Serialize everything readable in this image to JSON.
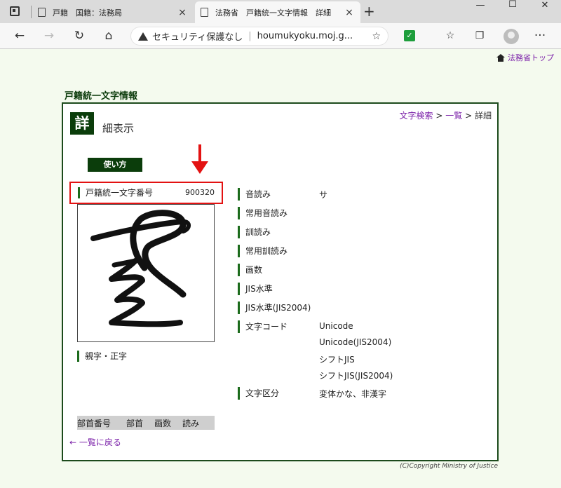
{
  "browser": {
    "tabs": [
      {
        "title": "戸籍　国籍：法務局",
        "close": "×"
      },
      {
        "title": "法務省　戸籍統一文字情報　詳細",
        "close": "×"
      }
    ],
    "new_tab": "+",
    "window": {
      "minimize": "—",
      "maximize": "☐",
      "close": "✕"
    },
    "nav": {
      "back": "←",
      "forward": "→",
      "reload": "↻",
      "home": "⌂"
    },
    "security_text": "セキュリティ保護なし",
    "url": "houmukyoku.moj.g...",
    "more": "···"
  },
  "page": {
    "top_link": "法務省トップ",
    "section_title": "戸籍統一文字情報",
    "detail_icon": "詳",
    "detail_title": "細表示",
    "breadcrumb": {
      "search": "文字検索",
      "sep": ">",
      "list": "一覧",
      "current": "詳細"
    },
    "howto_label": "使い方",
    "char_number_label": "戸籍統一文字番号",
    "char_number_value": "900320",
    "related_label": "親字・正字",
    "radical_headers": [
      "部首番号",
      "部首",
      "画数",
      "読み"
    ],
    "back_link": "← 一覧に戻る",
    "properties": [
      {
        "label": "音読み",
        "values": [
          "サ"
        ]
      },
      {
        "label": "常用音読み",
        "values": []
      },
      {
        "label": "訓読み",
        "values": []
      },
      {
        "label": "常用訓読み",
        "values": []
      },
      {
        "label": "画数",
        "values": []
      },
      {
        "label": "JIS水準",
        "values": []
      },
      {
        "label": "JIS水準(JIS2004)",
        "values": []
      },
      {
        "label": "文字コード",
        "values": [
          "Unicode",
          "Unicode(JIS2004)",
          "シフトJIS",
          "シフトJIS(JIS2004)"
        ]
      },
      {
        "label": "文字区分",
        "values": [
          "変体かな、非漢字"
        ]
      }
    ],
    "copyright": "(C)Copyright Ministry of Justice",
    "colors": {
      "accent": "#0b3d0b",
      "link": "#7a1fa8",
      "highlight": "#e31212",
      "page_bg": "#f4faee"
    }
  }
}
